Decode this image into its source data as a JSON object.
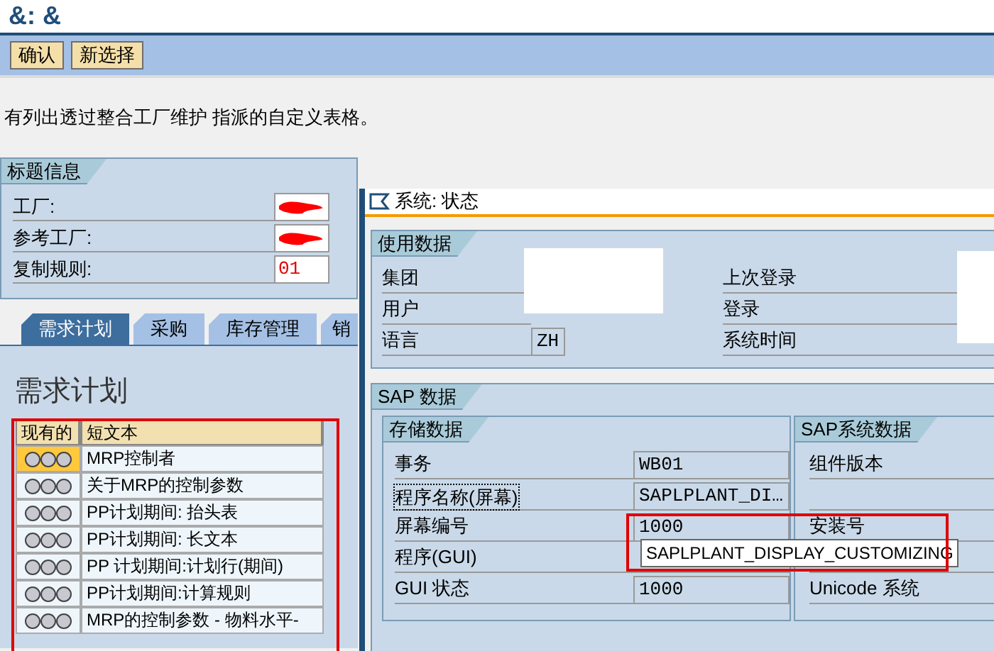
{
  "title": "&: &",
  "toolbar": {
    "buttons": [
      "确认",
      "新选择"
    ]
  },
  "message": "有列出透过整合工厂维护 指派的自定义表格。",
  "header": {
    "title": "标题信息",
    "fields": [
      {
        "label": "工厂:",
        "redacted": true
      },
      {
        "label": "参考工厂:",
        "redacted": true
      },
      {
        "label": "复制规则:",
        "value": "01",
        "redacted": false
      }
    ]
  },
  "tabs": [
    {
      "label": "需求计划",
      "selected": true
    },
    {
      "label": "采购",
      "selected": false
    },
    {
      "label": "库存管理",
      "selected": false
    },
    {
      "label": "销",
      "selected": false
    }
  ],
  "panel": {
    "title": "需求计划",
    "table": {
      "columns": [
        "现有的",
        "短文本"
      ],
      "rows": [
        {
          "text": "MRP控制者",
          "selected": true
        },
        {
          "text": "关于MRP的控制参数",
          "selected": false
        },
        {
          "text": "PP计划期间: 抬头表",
          "selected": false
        },
        {
          "text": "PP计划期间: 长文本",
          "selected": false
        },
        {
          "text": "PP 计划期间:计划行(期间)",
          "selected": false
        },
        {
          "text": "PP计划期间:计算规则",
          "selected": false
        },
        {
          "text": "MRP的控制参数 - 物料水平-",
          "selected": false
        }
      ]
    }
  },
  "popup": {
    "title": "系统: 状态",
    "usage": {
      "title": "使用数据",
      "left": [
        {
          "label": "集团"
        },
        {
          "label": "用户"
        },
        {
          "label": "语言",
          "value": "ZH"
        }
      ],
      "right": [
        {
          "label": "上次登录"
        },
        {
          "label": "登录"
        },
        {
          "label": "系统时间"
        }
      ]
    },
    "sap": {
      "title": "SAP 数据",
      "storage": {
        "title": "存储数据",
        "rows": [
          {
            "label": "事务",
            "value": "WB01",
            "focused": false
          },
          {
            "label": "程序名称(屏幕)",
            "value": "SAPLPLANT_DI…",
            "focused": true
          },
          {
            "label": "屏幕编号",
            "value": "1000",
            "focused": false
          },
          {
            "label": "程序(GUI)",
            "focused": false
          },
          {
            "label": "GUI 状态",
            "value": "1000",
            "focused": false
          }
        ]
      },
      "system": {
        "title": "SAP系统数据",
        "rows": [
          {
            "label": "组件版本"
          },
          {
            "label": "安装号"
          },
          {
            "label": "Unicode 系统"
          }
        ]
      }
    },
    "tooltip": "SAPLPLANT_DISPLAY_CUSTOMIZING"
  }
}
